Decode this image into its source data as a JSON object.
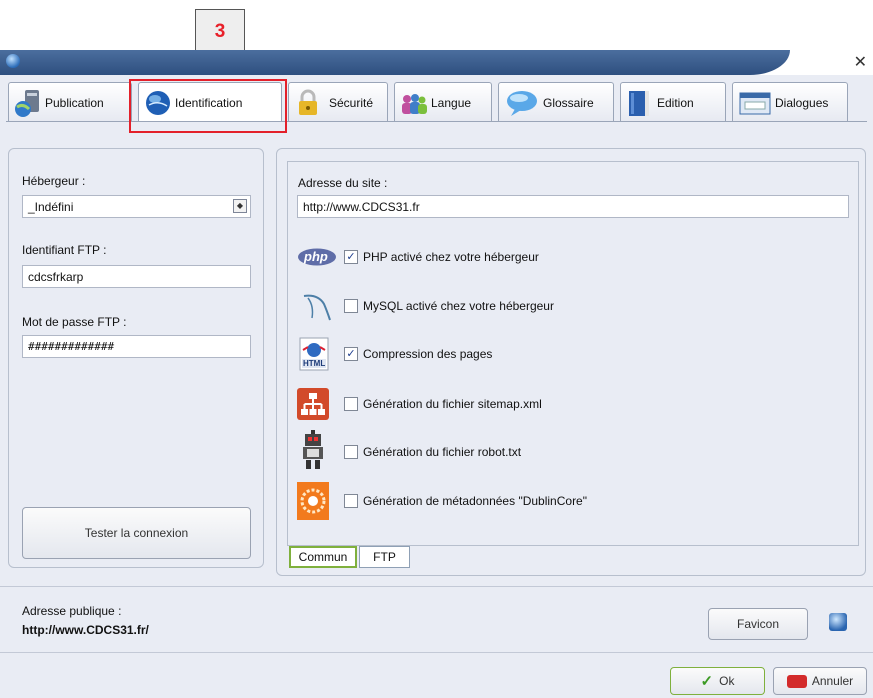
{
  "callout": {
    "number": "3"
  },
  "tabs": [
    {
      "label": "Publication",
      "icon": "server-globe-icon"
    },
    {
      "label": "Identification",
      "icon": "globe-icon"
    },
    {
      "label": "Sécurité",
      "icon": "padlock-icon"
    },
    {
      "label": "Langue",
      "icon": "people-icon"
    },
    {
      "label": "Glossaire",
      "icon": "speech-bubble-icon"
    },
    {
      "label": "Edition",
      "icon": "book-icon"
    },
    {
      "label": "Dialogues",
      "icon": "dialog-window-icon"
    }
  ],
  "left": {
    "host_label": "Hébergeur :",
    "host_value": "_Indéfini",
    "ftp_id_label": "Identifiant FTP :",
    "ftp_id_value": "cdcsfrkarp",
    "ftp_pass_label": "Mot de passe FTP :",
    "ftp_pass_value": "#############",
    "test_button": "Tester la connexion"
  },
  "right": {
    "site_label": "Adresse du site :",
    "site_value": "http://www.CDCS31.fr",
    "php_badge": "php",
    "html_badge": "HTML",
    "options": [
      {
        "label": "PHP activé chez votre hébergeur",
        "checked": true,
        "icon": "php-icon"
      },
      {
        "label": "MySQL activé chez votre hébergeur",
        "checked": false,
        "icon": "mysql-dolphin-icon"
      },
      {
        "label": "Compression des pages",
        "checked": true,
        "icon": "html-globe-icon"
      },
      {
        "label": "Génération du fichier sitemap.xml",
        "checked": false,
        "icon": "sitemap-icon"
      },
      {
        "label": "Génération du fichier robot.txt",
        "checked": false,
        "icon": "robot-icon"
      },
      {
        "label": "Génération de métadonnées \"DublinCore\"",
        "checked": false,
        "icon": "dublincore-icon"
      }
    ],
    "subtabs": [
      "Commun",
      "FTP"
    ]
  },
  "footer": {
    "public_label": "Adresse publique :",
    "public_value": "http://www.CDCS31.fr/",
    "favicon_button": "Favicon",
    "ok_button": "Ok",
    "cancel_button": "Annuler"
  },
  "colors": {
    "accent_red": "#e3202a",
    "titlebar": "#3a5d8f",
    "check": "#1d3d8f"
  }
}
